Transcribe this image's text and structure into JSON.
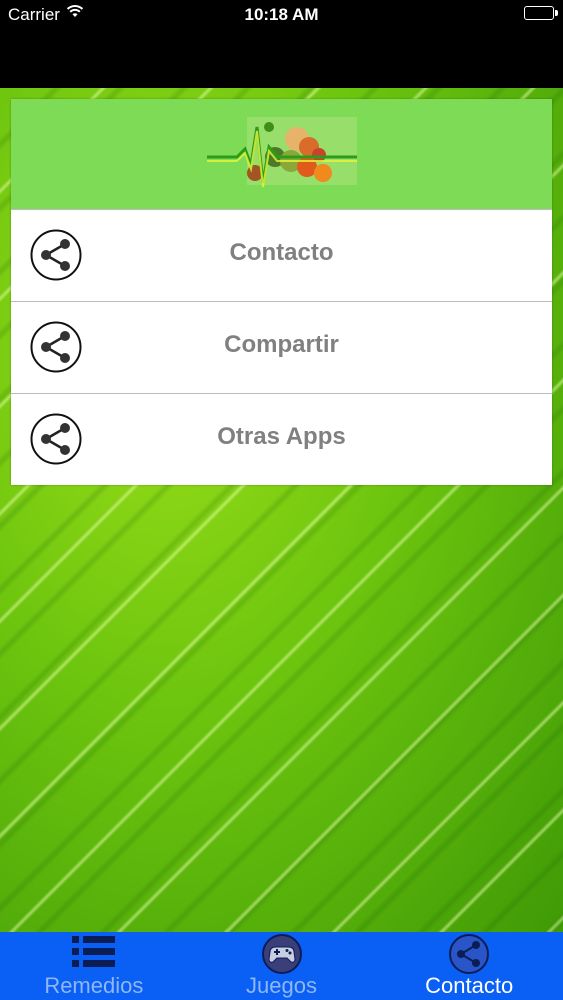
{
  "status_bar": {
    "carrier": "Carrier",
    "time": "10:18 AM"
  },
  "header": {
    "logo_icon": "health-food-logo"
  },
  "menu": {
    "items": [
      {
        "label": "Contacto",
        "icon": "share-icon"
      },
      {
        "label": "Compartir",
        "icon": "share-icon"
      },
      {
        "label": "Otras Apps",
        "icon": "share-icon"
      }
    ]
  },
  "tab_bar": {
    "tabs": [
      {
        "label": "Remedios",
        "icon": "list-icon",
        "active": false
      },
      {
        "label": "Juegos",
        "icon": "gamepad-icon",
        "active": false
      },
      {
        "label": "Contacto",
        "icon": "share-icon",
        "active": true
      }
    ],
    "background_color": "#0a5ff5"
  },
  "colors": {
    "header_green": "#7ddb55",
    "label_gray": "#808080"
  }
}
